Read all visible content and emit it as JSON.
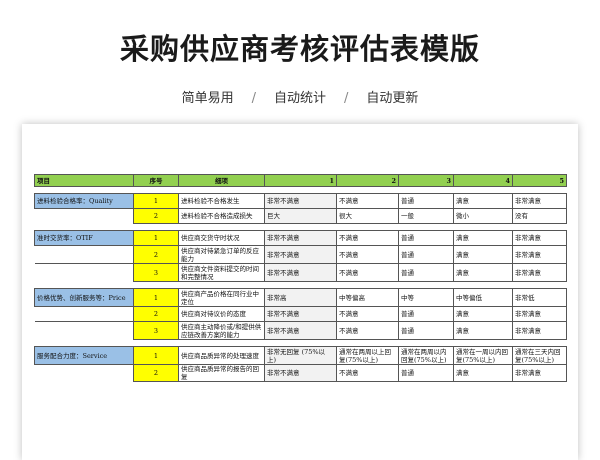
{
  "page": {
    "title": "采购供应商考核评估表模版",
    "tags": [
      "简单易用",
      "自动统计",
      "自动更新"
    ]
  },
  "table": {
    "headers": [
      "项目",
      "序号",
      "细项",
      "1",
      "2",
      "3",
      "4",
      "5"
    ],
    "sections": [
      {
        "category": "进料检验合格率：Quality",
        "rows": [
          {
            "seq": "1",
            "item": "进料检验不合格发生",
            "s1": "非常不满意",
            "s2": "不满意",
            "s3": "普通",
            "s4": "满意",
            "s5": "非常满意"
          },
          {
            "seq": "2",
            "item": "进料检验不合格造成损失",
            "s1": "巨大",
            "s2": "很大",
            "s3": "一般",
            "s4": "微小",
            "s5": "没有"
          }
        ]
      },
      {
        "category": "准时交货率：OTIF",
        "rows": [
          {
            "seq": "1",
            "item": "供应商交货守时状况",
            "s1": "非常不满意",
            "s2": "不满意",
            "s3": "普通",
            "s4": "满意",
            "s5": "非常满意"
          },
          {
            "seq": "2",
            "item": "供应商对待紧急订单的反应能力",
            "s1": "非常不满意",
            "s2": "不满意",
            "s3": "普通",
            "s4": "满意",
            "s5": "非常满意"
          },
          {
            "seq": "3",
            "item": "供应商文件资料提交的时间和完整情况",
            "s1": "非常不满意",
            "s2": "不满意",
            "s3": "普通",
            "s4": "满意",
            "s5": "非常满意"
          }
        ]
      },
      {
        "category": "价格优势、创新服务等：Price",
        "rows": [
          {
            "seq": "1",
            "item": "供应商产品价格在同行业中定位",
            "s1": "非常高",
            "s2": "中等偏高",
            "s3": "中等",
            "s4": "中等偏低",
            "s5": "非常低"
          },
          {
            "seq": "2",
            "item": "供应商对待议价的态度",
            "s1": "非常不满意",
            "s2": "不满意",
            "s3": "普通",
            "s4": "满意",
            "s5": "非常满意"
          },
          {
            "seq": "3",
            "item": "供应商主动降价或/和提供供应链改善方案的能力",
            "s1": "非常不满意",
            "s2": "不满意",
            "s3": "普通",
            "s4": "满意",
            "s5": "非常满意"
          }
        ]
      },
      {
        "category": "服务配合力度：Service",
        "rows": [
          {
            "seq": "1",
            "item": "供应商品质异常的处理速度",
            "s1": "非常无回复 (75%以上)",
            "s2": "通常在两周以上回复(75%以上)",
            "s3": "通常在两周以内回复(75%以上)",
            "s4": "通常在一周以内回复(75%以上)",
            "s5": "通常在三天内回复(75%以上)"
          },
          {
            "seq": "2",
            "item": "供应商品质异常的报告的回复",
            "s1": "非常不满意",
            "s2": "不满意",
            "s3": "普通",
            "s4": "满意",
            "s5": "非常满意"
          }
        ]
      }
    ]
  }
}
